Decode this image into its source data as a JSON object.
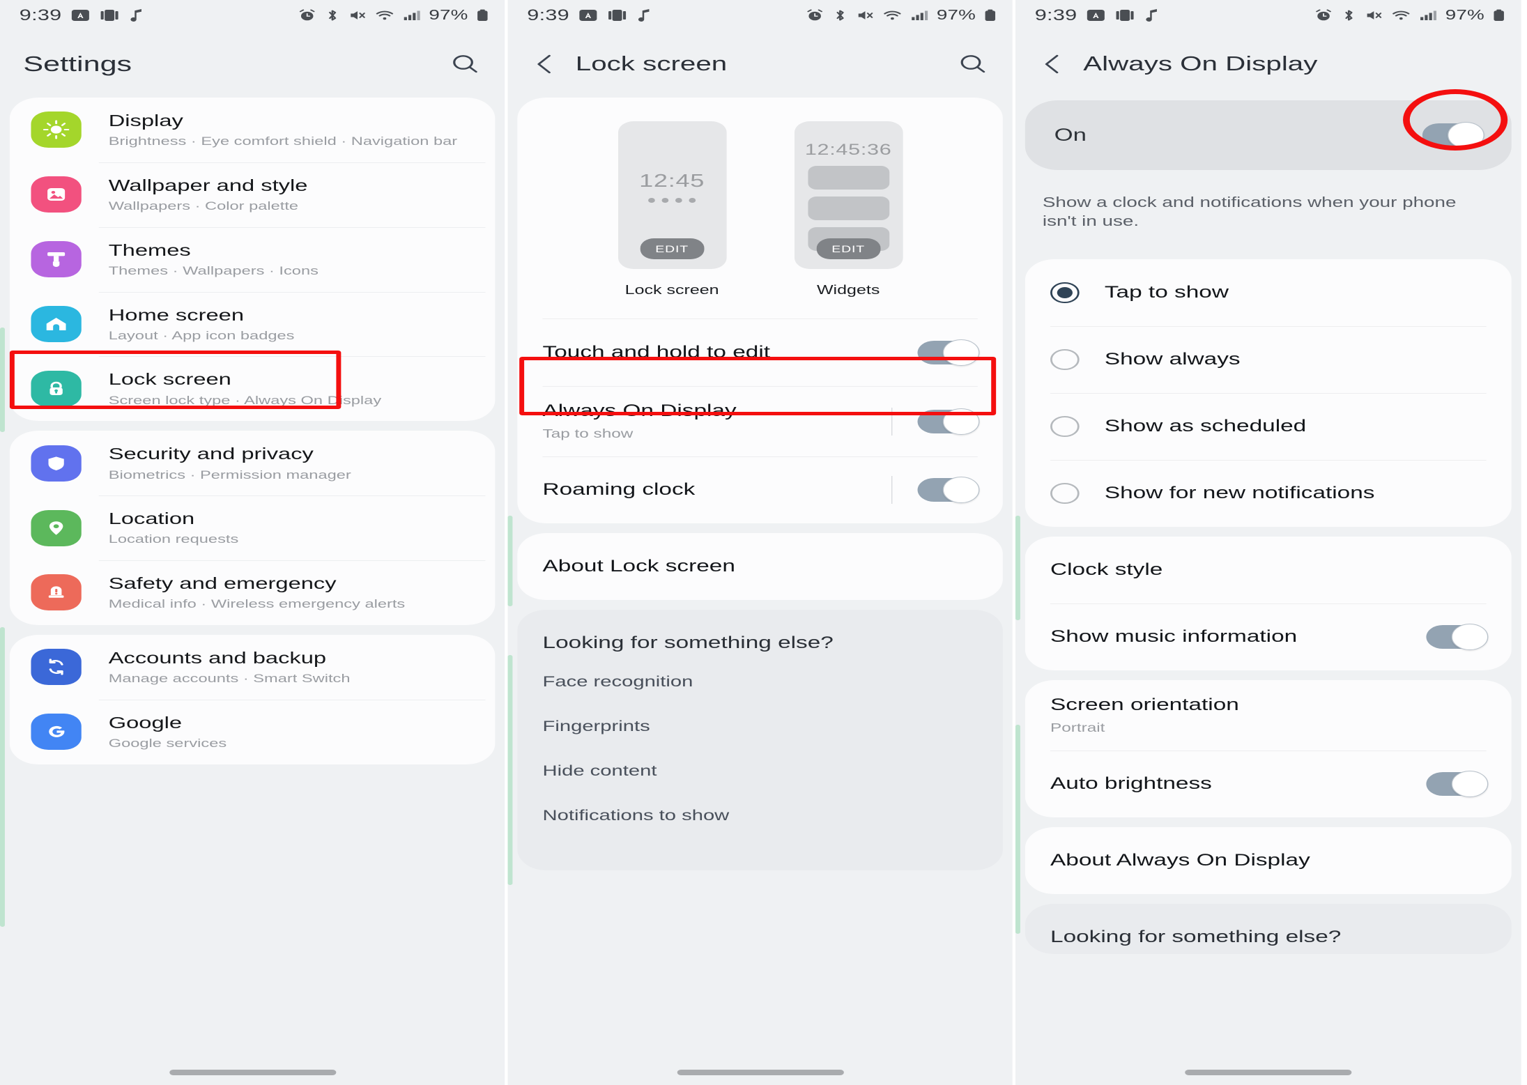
{
  "statusbar": {
    "time": "9:39",
    "battery": "97%",
    "left_icons": [
      "android-auto-icon",
      "screen-record-icon",
      "music-note-icon"
    ],
    "right_icons": [
      "alarm-icon",
      "bluetooth-icon",
      "mute-icon",
      "wifi-icon",
      "signal-icon",
      "battery-icon"
    ]
  },
  "panel1": {
    "header": {
      "title": "Settings",
      "search_icon": "search-icon"
    },
    "groups": [
      {
        "items": [
          {
            "title": "Display",
            "sub": "Brightness  ·  Eye comfort shield  ·  Navigation bar",
            "icon": "brightness-icon",
            "color": "#a4d62b",
            "highlight": false
          },
          {
            "title": "Wallpaper and style",
            "sub": "Wallpapers  ·  Color palette",
            "icon": "image-icon",
            "color": "#f2517f",
            "highlight": false
          },
          {
            "title": "Themes",
            "sub": "Themes  ·  Wallpapers  ·  Icons",
            "icon": "paintbrush-icon",
            "color": "#b765e0",
            "highlight": false
          },
          {
            "title": "Home screen",
            "sub": "Layout  ·  App icon badges",
            "icon": "home-icon",
            "color": "#2bb7e0",
            "highlight": false
          },
          {
            "title": "Lock screen",
            "sub": "Screen lock type  ·  Always On Display",
            "icon": "lock-icon",
            "color": "#2eb9a4",
            "highlight": true
          }
        ]
      },
      {
        "items": [
          {
            "title": "Security and privacy",
            "sub": "Biometrics  ·  Permission manager",
            "icon": "shield-icon",
            "color": "#6172ee",
            "highlight": false
          },
          {
            "title": "Location",
            "sub": "Location requests",
            "icon": "pin-icon",
            "color": "#5cb85c",
            "highlight": false
          },
          {
            "title": "Safety and emergency",
            "sub": "Medical info  ·  Wireless emergency alerts",
            "icon": "siren-icon",
            "color": "#ed6a5a",
            "highlight": false
          }
        ]
      },
      {
        "items": [
          {
            "title": "Accounts and backup",
            "sub": "Manage accounts  ·  Smart Switch",
            "icon": "sync-icon",
            "color": "#3b68d8",
            "highlight": false
          },
          {
            "title": "Google",
            "sub": "Google services",
            "icon": "google-g-icon",
            "color": "#4285f4",
            "highlight": false
          }
        ]
      }
    ]
  },
  "panel2": {
    "header": {
      "title": "Lock screen",
      "back_icon": "chevron-left-icon",
      "search_icon": "search-icon"
    },
    "previews": [
      {
        "label": "Lock screen",
        "clock": "12:45",
        "edit": "EDIT",
        "dots": 4,
        "bars": 0
      },
      {
        "label": "Widgets",
        "clock": "12:45:36",
        "edit": "EDIT",
        "dots": 0,
        "bars": 3
      }
    ],
    "rows": [
      {
        "label": "Touch and hold to edit",
        "sub": "",
        "toggle": true,
        "separator": false,
        "highlight": false
      },
      {
        "label": "Always On Display",
        "sub": "Tap to show",
        "toggle": true,
        "separator": true,
        "highlight": true
      },
      {
        "label": "Roaming clock",
        "sub": "",
        "toggle": true,
        "separator": true,
        "highlight": false
      }
    ],
    "about": {
      "label": "About Lock screen"
    },
    "more": {
      "heading": "Looking for something else?",
      "links": [
        "Face recognition",
        "Fingerprints",
        "Hide content",
        "Notifications to show"
      ]
    }
  },
  "panel3": {
    "header": {
      "title": "Always On Display",
      "back_icon": "chevron-left-icon"
    },
    "master": {
      "label": "On",
      "toggle": true,
      "highlight": true
    },
    "description": "Show a clock and notifications when your phone isn't in use.",
    "options": [
      {
        "label": "Tap to show",
        "selected": true
      },
      {
        "label": "Show always",
        "selected": false
      },
      {
        "label": "Show as scheduled",
        "selected": false
      },
      {
        "label": "Show for new notifications",
        "selected": false
      }
    ],
    "rows": [
      {
        "label": "Clock style",
        "sub": "",
        "toggle": false
      },
      {
        "label": "Show music information",
        "sub": "",
        "toggle": true
      }
    ],
    "rows2": [
      {
        "label": "Screen orientation",
        "sub": "Portrait",
        "toggle": false
      },
      {
        "label": "Auto brightness",
        "sub": "",
        "toggle": true
      }
    ],
    "about": {
      "label": "About Always On Display"
    },
    "more": {
      "heading": "Looking for something else?"
    }
  }
}
